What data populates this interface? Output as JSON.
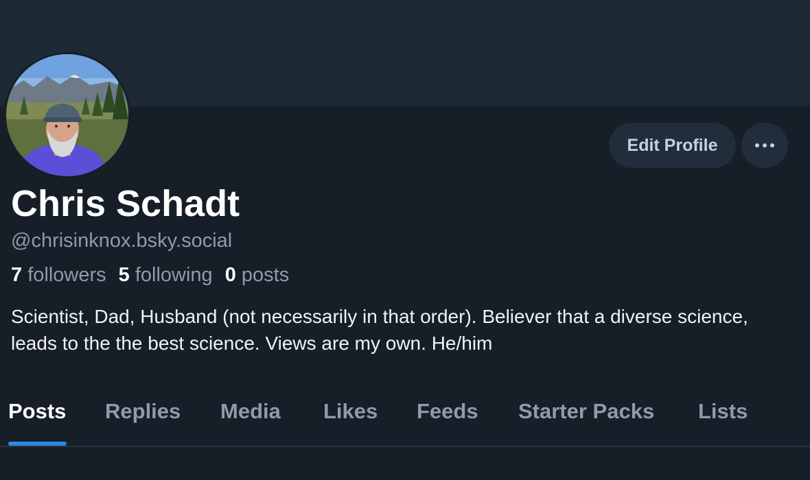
{
  "profile": {
    "display_name": "Chris Schadt",
    "handle": "@chrisinknox.bsky.social",
    "bio": "Scientist, Dad, Husband (not necessarily in that order). Believer that a diverse science, leads to the the best science. Views are my own. He/him"
  },
  "stats": {
    "followers_count": "7",
    "followers_label": "followers",
    "following_count": "5",
    "following_label": "following",
    "posts_count": "0",
    "posts_label": "posts"
  },
  "actions": {
    "edit_profile_label": "Edit Profile",
    "more_icon": "ellipsis-icon"
  },
  "tabs": [
    {
      "label": "Posts",
      "active": true
    },
    {
      "label": "Replies",
      "active": false
    },
    {
      "label": "Media",
      "active": false
    },
    {
      "label": "Likes",
      "active": false
    },
    {
      "label": "Feeds",
      "active": false
    },
    {
      "label": "Starter Packs",
      "active": false
    },
    {
      "label": "Lists",
      "active": false
    }
  ],
  "colors": {
    "background": "#161e27",
    "banner": "#1e2936",
    "button_bg": "#212d3b",
    "accent": "#2f87e8",
    "muted_text": "#8f9bab"
  }
}
